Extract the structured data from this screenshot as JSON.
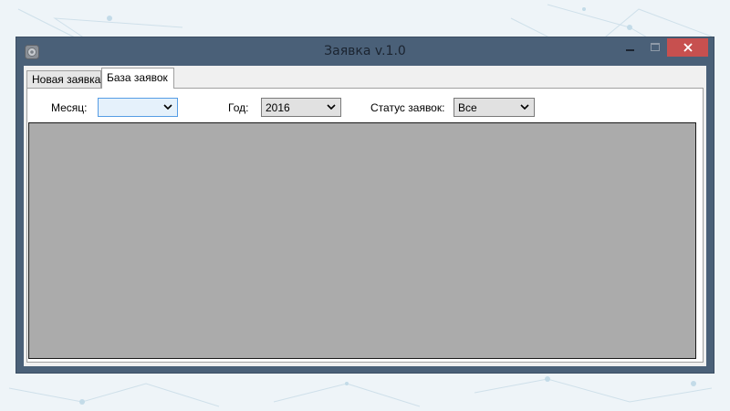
{
  "window": {
    "title": "Заявка v.1.0"
  },
  "tabs": [
    {
      "label": "Новая заявка",
      "selected": false
    },
    {
      "label": "База заявок",
      "selected": true
    }
  ],
  "filters": {
    "month_label": "Месяц:",
    "month_value": "",
    "year_label": "Год:",
    "year_value": "2016",
    "status_label": "Статус заявок:",
    "status_value": "Все"
  },
  "colors": {
    "titlebar": "#4a6078",
    "close_button": "#c7504f",
    "grid_background": "#ababab"
  },
  "icons": {
    "app": "app-icon",
    "minimize": "minimize-icon",
    "maximize": "maximize-icon",
    "close": "close-icon",
    "dropdown": "chevron-down-icon"
  }
}
